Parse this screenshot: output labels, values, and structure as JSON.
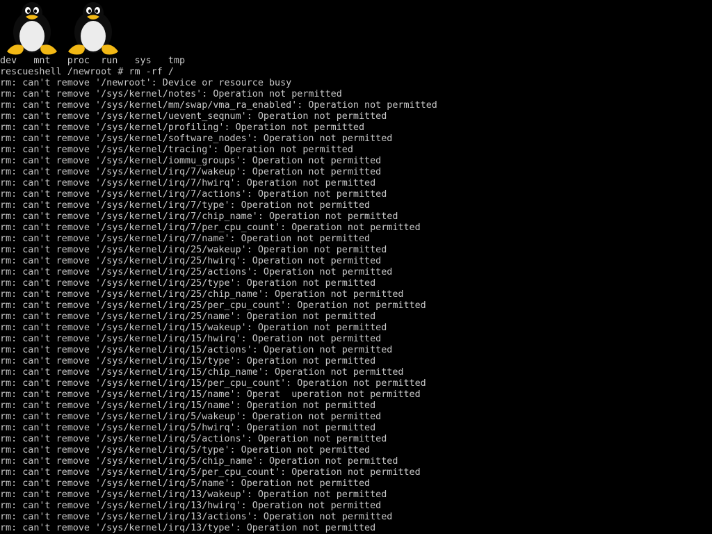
{
  "colors": {
    "background": "#000000",
    "text": "#c8c8c8"
  },
  "logos": [
    {
      "icon": "tux-penguin-icon"
    },
    {
      "icon": "tux-penguin-icon"
    }
  ],
  "console": {
    "lines": [
      "dev   mnt   proc  run   sys   tmp",
      "rescueshell /newroot # rm -rf /",
      "rm: can't remove '/newroot': Device or resource busy",
      "rm: can't remove '/sys/kernel/notes': Operation not permitted",
      "rm: can't remove '/sys/kernel/mm/swap/vma_ra_enabled': Operation not permitted",
      "rm: can't remove '/sys/kernel/uevent_seqnum': Operation not permitted",
      "rm: can't remove '/sys/kernel/profiling': Operation not permitted",
      "rm: can't remove '/sys/kernel/software_nodes': Operation not permitted",
      "rm: can't remove '/sys/kernel/tracing': Operation not permitted",
      "rm: can't remove '/sys/kernel/iommu_groups': Operation not permitted",
      "rm: can't remove '/sys/kernel/irq/7/wakeup': Operation not permitted",
      "rm: can't remove '/sys/kernel/irq/7/hwirq': Operation not permitted",
      "rm: can't remove '/sys/kernel/irq/7/actions': Operation not permitted",
      "rm: can't remove '/sys/kernel/irq/7/type': Operation not permitted",
      "rm: can't remove '/sys/kernel/irq/7/chip_name': Operation not permitted",
      "rm: can't remove '/sys/kernel/irq/7/per_cpu_count': Operation not permitted",
      "rm: can't remove '/sys/kernel/irq/7/name': Operation not permitted",
      "rm: can't remove '/sys/kernel/irq/25/wakeup': Operation not permitted",
      "rm: can't remove '/sys/kernel/irq/25/hwirq': Operation not permitted",
      "rm: can't remove '/sys/kernel/irq/25/actions': Operation not permitted",
      "rm: can't remove '/sys/kernel/irq/25/type': Operation not permitted",
      "rm: can't remove '/sys/kernel/irq/25/chip_name': Operation not permitted",
      "rm: can't remove '/sys/kernel/irq/25/per_cpu_count': Operation not permitted",
      "rm: can't remove '/sys/kernel/irq/25/name': Operation not permitted",
      "rm: can't remove '/sys/kernel/irq/15/wakeup': Operation not permitted",
      "rm: can't remove '/sys/kernel/irq/15/hwirq': Operation not permitted",
      "rm: can't remove '/sys/kernel/irq/15/actions': Operation not permitted",
      "rm: can't remove '/sys/kernel/irq/15/type': Operation not permitted",
      "rm: can't remove '/sys/kernel/irq/15/chip_name': Operation not permitted",
      "rm: can't remove '/sys/kernel/irq/15/per_cpu_count': Operation not permitted",
      "rm: can't remove '/sys/kernel/irq/15/name': Operat  uperation not permitted",
      "rm: can't remove '/sys/kernel/irq/15/name': Operation not permitted",
      "rm: can't remove '/sys/kernel/irq/5/wakeup': Operation not permitted",
      "rm: can't remove '/sys/kernel/irq/5/hwirq': Operation not permitted",
      "rm: can't remove '/sys/kernel/irq/5/actions': Operation not permitted",
      "rm: can't remove '/sys/kernel/irq/5/type': Operation not permitted",
      "rm: can't remove '/sys/kernel/irq/5/chip_name': Operation not permitted",
      "rm: can't remove '/sys/kernel/irq/5/per_cpu_count': Operation not permitted",
      "rm: can't remove '/sys/kernel/irq/5/name': Operation not permitted",
      "rm: can't remove '/sys/kernel/irq/13/wakeup': Operation not permitted",
      "rm: can't remove '/sys/kernel/irq/13/hwirq': Operation not permitted",
      "rm: can't remove '/sys/kernel/irq/13/actions': Operation not permitted",
      "rm: can't remove '/sys/kernel/irq/13/type': Operation not permitted"
    ]
  }
}
